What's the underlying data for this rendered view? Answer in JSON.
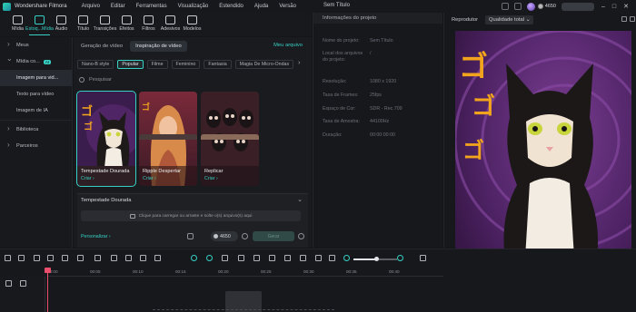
{
  "titlebar": {
    "app_name": "Wondershare Filmora",
    "menus": [
      "Arquivo",
      "Editar",
      "Ferramentas",
      "Visualização",
      "Estendido",
      "Ajuda",
      "Versão"
    ],
    "document_title": "Sem Título",
    "credits": "4650"
  },
  "toolbar": {
    "tools": [
      {
        "label": "Mídia",
        "icon": "media-icon"
      },
      {
        "label": "Estoq...Mídia",
        "icon": "stock-media-icon",
        "active": true
      },
      {
        "label": "Áudio",
        "icon": "audio-icon"
      },
      {
        "label": "Título",
        "icon": "title-icon"
      },
      {
        "label": "Transições",
        "icon": "transitions-icon"
      },
      {
        "label": "Efeitos",
        "icon": "effects-icon"
      },
      {
        "label": "Filtros",
        "icon": "filters-icon"
      },
      {
        "label": "Adesivos",
        "icon": "stickers-icon"
      },
      {
        "label": "Modelos",
        "icon": "templates-icon"
      }
    ]
  },
  "sidebar": {
    "items": [
      {
        "label": "Meus"
      },
      {
        "label": "Mídia co...",
        "badge": "AI"
      },
      {
        "label": "Imagem para vid..."
      },
      {
        "label": "Texto para vídeo"
      },
      {
        "label": "Imagem de IA"
      },
      {
        "label": "Biblioteca"
      },
      {
        "label": "Parceiros"
      }
    ]
  },
  "content": {
    "tabs": [
      "Geração de vídeo",
      "Inspiração de vídeo"
    ],
    "my_file": "Meu arquivo",
    "filters": [
      "Nano-B style",
      "Popular",
      "Filme",
      "Feminino",
      "Fantasia",
      "Magia De Micro-Ondas"
    ],
    "search_placeholder": "Pesquisar",
    "cards": [
      {
        "caption": "Tempestade Dourada",
        "cta": "Criar ›"
      },
      {
        "caption": "Ripple Despertar",
        "cta": "Criar ›"
      },
      {
        "caption": "Replicar",
        "cta": "Criar ›"
      }
    ],
    "panel": {
      "title": "Tempestade Dourada",
      "upload_hint": "Clique para carregar ou arraste e solte o(s) arquivo(s) aqui",
      "personalize": "Personalizar ›",
      "credits": "4650",
      "generate_label": "Gerar"
    }
  },
  "info": {
    "heading": "Informações do projeto",
    "rows": [
      {
        "label": "Nome do projeto:",
        "value": "Sem Título"
      },
      {
        "label": "Local dos arquivos do projeto:",
        "value": "/"
      },
      {
        "label": "Resolução:",
        "value": "1080 x 1920"
      },
      {
        "label": "Taxa de Frames:",
        "value": "25fps"
      },
      {
        "label": "Espaço de Cor:",
        "value": "SDR - Rec.709"
      },
      {
        "label": "Taxa de Amostra:",
        "value": "44100Hz"
      },
      {
        "label": "Duração:",
        "value": "00:00:00:00"
      }
    ]
  },
  "player": {
    "label": "Reprodutor",
    "quality": "Qualidade total"
  },
  "timeline": {
    "ticks": [
      "00:00",
      "00:05",
      "00:10",
      "00:15",
      "00:20",
      "00:25",
      "00:30",
      "00:35",
      "00:40"
    ],
    "zoom_fraction": 0.55
  }
}
